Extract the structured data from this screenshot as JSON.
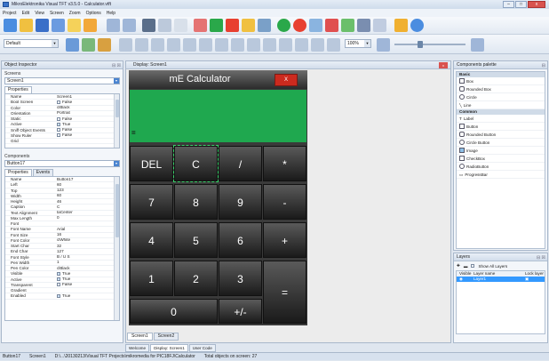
{
  "window": {
    "title": "MikroElektronika Visual TFT v3.5.0 - Calculator.vtft"
  },
  "menu": [
    "Project",
    "Edit",
    "View",
    "Screen",
    "Zoom",
    "Options",
    "Help"
  ],
  "toolbar": {
    "scheme": "Default",
    "zoom": "100%"
  },
  "object_inspector": {
    "title": "Object Inspector",
    "screens_label": "Screens",
    "screen_value": "Screen1",
    "tabs": [
      "Properties"
    ],
    "screen_props": [
      {
        "k": "Name",
        "v": "Screen1"
      },
      {
        "k": "Boot Screen",
        "v": "False",
        "cb": true,
        "chk": false
      },
      {
        "k": "Color",
        "v": "clBlack"
      },
      {
        "k": "Orientation",
        "v": "Portrait"
      },
      {
        "k": "Static",
        "v": "False",
        "cb": true,
        "chk": false
      },
      {
        "k": "Active",
        "v": "True",
        "cb": true,
        "chk": true
      },
      {
        "k": "Sniff Object Events",
        "v": "False",
        "cb": true,
        "chk": false
      },
      {
        "k": "Show Ruler",
        "v": "False",
        "cb": true,
        "chk": false
      },
      {
        "k": "Grid",
        "v": ""
      }
    ],
    "components_label": "Components",
    "component_value": "Button17",
    "comp_tabs": [
      "Properties",
      "Events"
    ],
    "comp_props": [
      {
        "k": "Name",
        "v": "Button17"
      },
      {
        "k": "Left",
        "v": "60"
      },
      {
        "k": "Top",
        "v": "123"
      },
      {
        "k": "Width",
        "v": "60"
      },
      {
        "k": "Height",
        "v": "46"
      },
      {
        "k": "Caption",
        "v": "C"
      },
      {
        "k": "Text Alignment",
        "v": "taCenter"
      },
      {
        "k": "Max Length",
        "v": "0"
      },
      {
        "k": "Font",
        "v": ""
      },
      {
        "k": "Font Name",
        "v": "Arial"
      },
      {
        "k": "Font Size",
        "v": "16"
      },
      {
        "k": "Font Color",
        "v": "clWhite"
      },
      {
        "k": "Start Char",
        "v": "32"
      },
      {
        "k": "End Char",
        "v": "127"
      },
      {
        "k": "Font Style",
        "v": "B / U S"
      },
      {
        "k": "Pen Width",
        "v": "1"
      },
      {
        "k": "Pen Color",
        "v": "clBlack"
      },
      {
        "k": "Visible",
        "v": "True",
        "cb": true,
        "chk": true
      },
      {
        "k": "Active",
        "v": "True",
        "cb": true,
        "chk": true
      },
      {
        "k": "Transparent",
        "v": "False",
        "cb": true,
        "chk": false
      },
      {
        "k": "Gradient",
        "v": ""
      },
      {
        "k": "Enabled",
        "v": "True",
        "cb": true,
        "chk": true
      }
    ]
  },
  "design": {
    "title": "Display: Screen1",
    "calc_title": "mE Calculator",
    "close_label": "X",
    "display_text": "=",
    "keys": [
      "DEL",
      "C",
      "/",
      "*",
      "7",
      "8",
      "9",
      "-",
      "4",
      "5",
      "6",
      "+",
      "1",
      "2",
      "3",
      "=",
      "0",
      "+/-"
    ]
  },
  "screen_tabs": [
    "Screen1",
    "Screen2"
  ],
  "doc_tabs": [
    "Welcome",
    "Display: Screen1",
    "User Code"
  ],
  "palette": {
    "title": "Components palette",
    "basic_group": "Basic",
    "basic": [
      "Box",
      "Rounded Box",
      "Circle",
      "Line"
    ],
    "common_group": "Common",
    "common": [
      "Label",
      "Button",
      "Rounded Button",
      "Circle Button",
      "Image",
      "CheckBox",
      "RadioButton",
      "ProgressBar"
    ]
  },
  "layers": {
    "title": "Layers",
    "show_all": "Show All Layers",
    "cols": [
      "Visible",
      "Layer name",
      "Lock layer"
    ],
    "row": "Layer1"
  },
  "status": {
    "object": "Button17",
    "screen": "Screen1",
    "path": "D:\\...\\20130213\\Visual TFT Projects\\mikromedia for PIC18FJ\\Calculator",
    "total": "Total objects on screen: 27"
  }
}
